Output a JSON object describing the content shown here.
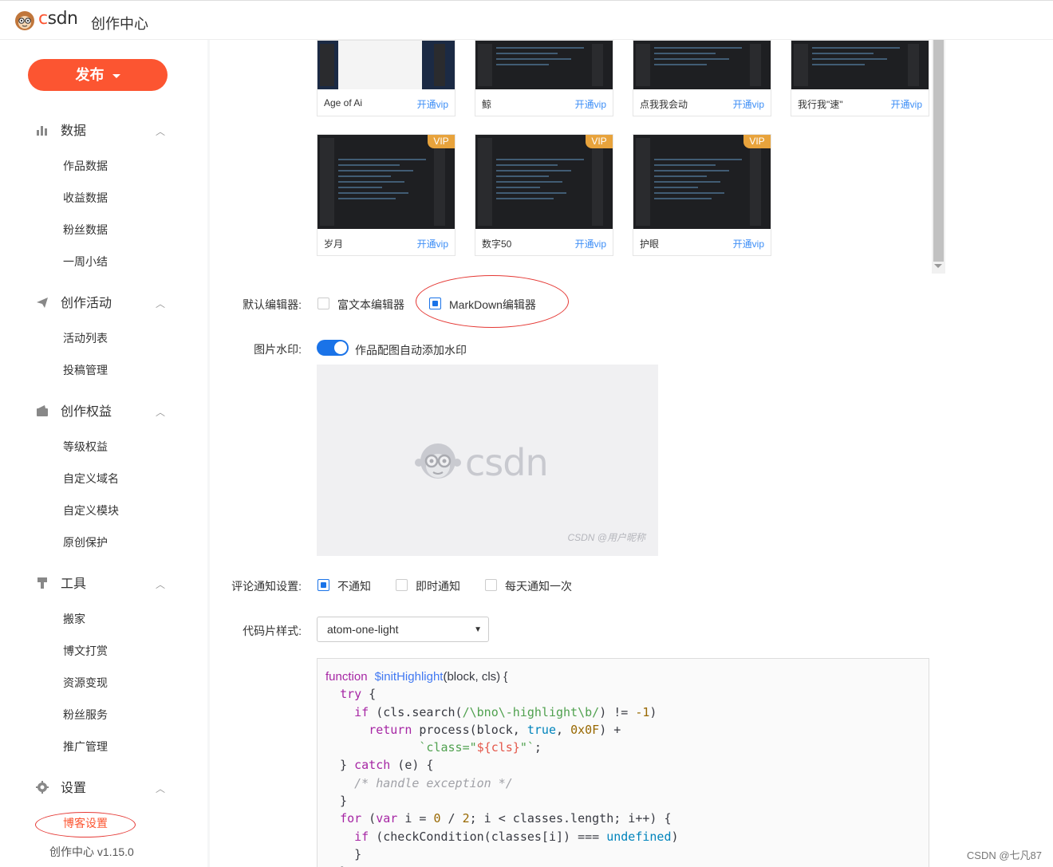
{
  "header": {
    "logo_text": "csdn",
    "title": "创作中心"
  },
  "sidebar": {
    "publish_label": "发布",
    "groups": [
      {
        "title": "数据",
        "items": [
          "作品数据",
          "收益数据",
          "粉丝数据",
          "一周小结"
        ]
      },
      {
        "title": "创作活动",
        "items": [
          "活动列表",
          "投稿管理"
        ]
      },
      {
        "title": "创作权益",
        "items": [
          "等级权益",
          "自定义域名",
          "自定义模块",
          "原创保护"
        ]
      },
      {
        "title": "工具",
        "items": [
          "搬家",
          "博文打赏",
          "资源变现",
          "粉丝服务",
          "推广管理"
        ]
      },
      {
        "title": "设置",
        "items": [
          "博客设置"
        ]
      }
    ],
    "version": "创作中心 v1.15.0"
  },
  "themes": {
    "row1": [
      {
        "name": "Age of Ai",
        "action": "开通vip"
      },
      {
        "name": "鲸",
        "action": "开通vip"
      },
      {
        "name": "点我我会动",
        "action": "开通vip"
      },
      {
        "name": "我行我\"速\"",
        "action": "开通vip"
      }
    ],
    "row2": [
      {
        "name": "岁月",
        "action": "开通vip",
        "badge": "VIP"
      },
      {
        "name": "数字50",
        "action": "开通vip",
        "badge": "VIP"
      },
      {
        "name": "护眼",
        "action": "开通vip",
        "badge": "VIP"
      }
    ]
  },
  "settings": {
    "editor_label": "默认编辑器:",
    "editor_options": [
      "富文本编辑器",
      "MarkDown编辑器"
    ],
    "editor_selected": "MarkDown编辑器",
    "watermark_label": "图片水印:",
    "watermark_toggle_text": "作品配图自动添加水印",
    "watermark_on": true,
    "watermark_preview_logo": "csdn",
    "watermark_preview_caption": "CSDN @用户昵称",
    "comment_label": "评论通知设置:",
    "comment_options": [
      "不通知",
      "即时通知",
      "每天通知一次"
    ],
    "comment_selected": "不通知",
    "code_label": "代码片样式:",
    "code_style_value": "atom-one-light"
  },
  "footer_tag": "CSDN @七凡87",
  "colors": {
    "brand": "#fc5531",
    "accent": "#1a73e8",
    "link": "#3d8ef6",
    "vip_badge": "#e8a33c"
  }
}
